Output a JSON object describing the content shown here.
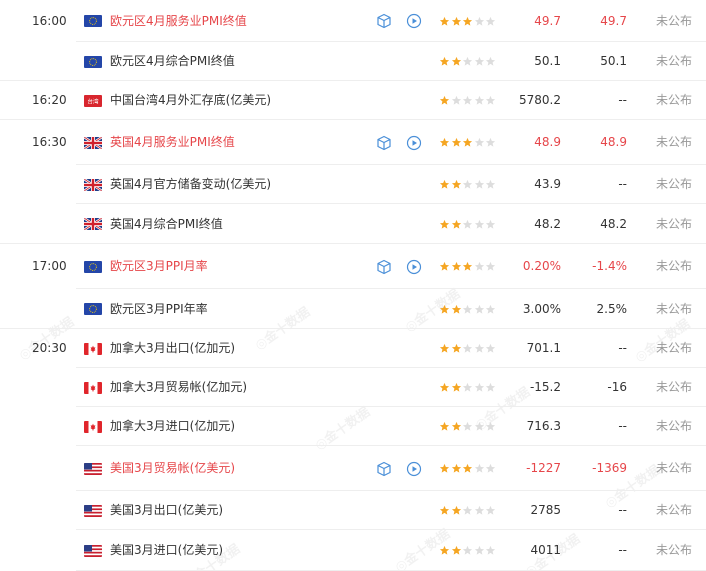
{
  "watermark_text": "金十数据",
  "rows": [
    {
      "time": "16:00",
      "flag": "eu",
      "name": "欧元区4月服务业PMI终值",
      "highlight": true,
      "icons": true,
      "stars": 3,
      "actual": "49.7",
      "actual_hi": true,
      "previous": "49.7",
      "previous_hi": true,
      "status": "未公布"
    },
    {
      "time": "",
      "flag": "eu",
      "name": "欧元区4月综合PMI终值",
      "highlight": false,
      "icons": false,
      "stars": 2,
      "actual": "50.1",
      "actual_hi": false,
      "previous": "50.1",
      "previous_hi": false,
      "status": "未公布"
    },
    {
      "time": "16:20",
      "flag": "tw",
      "name": "中国台湾4月外汇存底(亿美元)",
      "highlight": false,
      "icons": false,
      "stars": 1,
      "actual": "5780.2",
      "actual_hi": false,
      "previous": "--",
      "previous_hi": false,
      "status": "未公布"
    },
    {
      "time": "16:30",
      "flag": "uk",
      "name": "英国4月服务业PMI终值",
      "highlight": true,
      "icons": true,
      "stars": 3,
      "actual": "48.9",
      "actual_hi": true,
      "previous": "48.9",
      "previous_hi": true,
      "status": "未公布"
    },
    {
      "time": "",
      "flag": "uk",
      "name": "英国4月官方储备变动(亿美元)",
      "highlight": false,
      "icons": false,
      "stars": 2,
      "actual": "43.9",
      "actual_hi": false,
      "previous": "--",
      "previous_hi": false,
      "status": "未公布"
    },
    {
      "time": "",
      "flag": "uk",
      "name": "英国4月综合PMI终值",
      "highlight": false,
      "icons": false,
      "stars": 2,
      "actual": "48.2",
      "actual_hi": false,
      "previous": "48.2",
      "previous_hi": false,
      "status": "未公布"
    },
    {
      "time": "17:00",
      "flag": "eu",
      "name": "欧元区3月PPI月率",
      "highlight": true,
      "icons": true,
      "stars": 3,
      "actual": "0.20%",
      "actual_hi": true,
      "previous": "-1.4%",
      "previous_hi": true,
      "status": "未公布"
    },
    {
      "time": "",
      "flag": "eu",
      "name": "欧元区3月PPI年率",
      "highlight": false,
      "icons": false,
      "stars": 2,
      "actual": "3.00%",
      "actual_hi": false,
      "previous": "2.5%",
      "previous_hi": false,
      "status": "未公布"
    },
    {
      "time": "20:30",
      "flag": "ca",
      "name": "加拿大3月出口(亿加元)",
      "highlight": false,
      "icons": false,
      "stars": 2,
      "actual": "701.1",
      "actual_hi": false,
      "previous": "--",
      "previous_hi": false,
      "status": "未公布"
    },
    {
      "time": "",
      "flag": "ca",
      "name": "加拿大3月贸易帐(亿加元)",
      "highlight": false,
      "icons": false,
      "stars": 2,
      "actual": "-15.2",
      "actual_hi": false,
      "previous": "-16",
      "previous_hi": false,
      "status": "未公布"
    },
    {
      "time": "",
      "flag": "ca",
      "name": "加拿大3月进口(亿加元)",
      "highlight": false,
      "icons": false,
      "stars": 2,
      "actual": "716.3",
      "actual_hi": false,
      "previous": "--",
      "previous_hi": false,
      "status": "未公布"
    },
    {
      "time": "",
      "flag": "us",
      "name": "美国3月贸易帐(亿美元)",
      "highlight": true,
      "icons": true,
      "stars": 3,
      "actual": "-1227",
      "actual_hi": true,
      "previous": "-1369",
      "previous_hi": true,
      "status": "未公布"
    },
    {
      "time": "",
      "flag": "us",
      "name": "美国3月出口(亿美元)",
      "highlight": false,
      "icons": false,
      "stars": 2,
      "actual": "2785",
      "actual_hi": false,
      "previous": "--",
      "previous_hi": false,
      "status": "未公布"
    },
    {
      "time": "",
      "flag": "us",
      "name": "美国3月进口(亿美元)",
      "highlight": false,
      "icons": false,
      "stars": 2,
      "actual": "4011",
      "actual_hi": false,
      "previous": "--",
      "previous_hi": false,
      "status": "未公布"
    }
  ],
  "tw_flag_text": "台湾",
  "icons": {
    "detail": "cube-icon",
    "video": "play-circle-icon",
    "star": "star-icon"
  },
  "colors": {
    "highlight": "#e6464a",
    "star_on": "#f5a623",
    "star_off": "#dddddd",
    "icon": "#4a8fd8",
    "status": "#999999"
  }
}
